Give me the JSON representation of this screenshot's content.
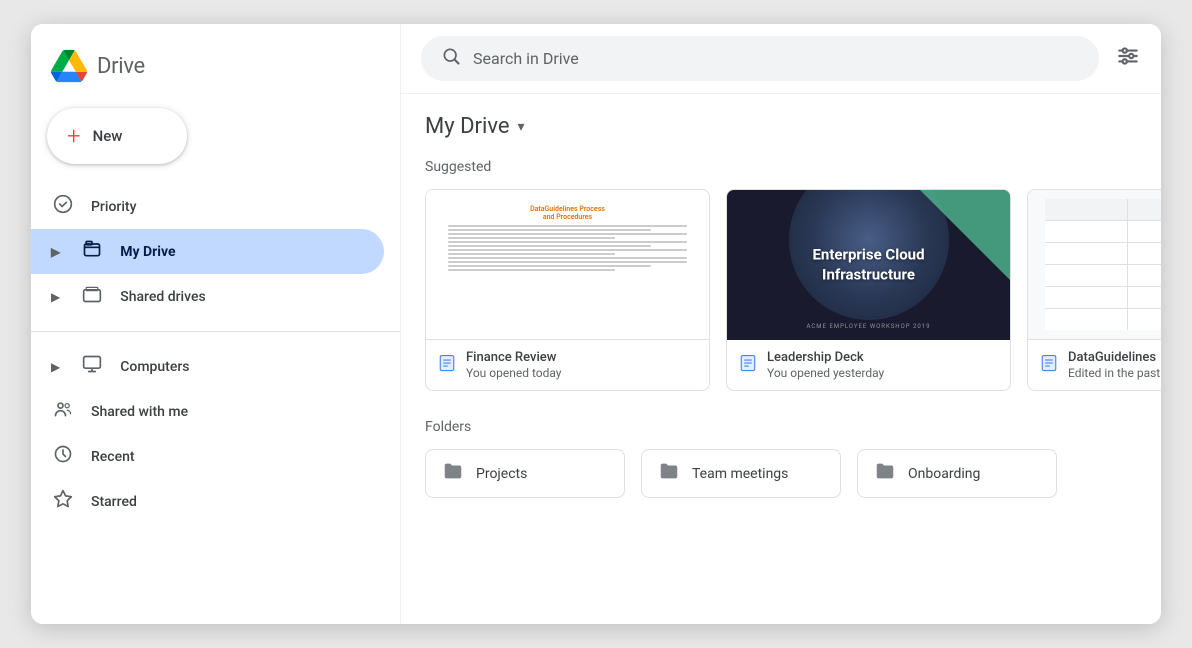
{
  "app": {
    "name": "Drive",
    "logo_alt": "Google Drive"
  },
  "search": {
    "placeholder": "Search in Drive",
    "icon": "🔍"
  },
  "sidebar": {
    "new_button_label": "New",
    "items": [
      {
        "id": "priority",
        "label": "Priority",
        "icon": "☑",
        "active": false,
        "expandable": false
      },
      {
        "id": "my-drive",
        "label": "My Drive",
        "icon": "🖥",
        "active": true,
        "expandable": true
      },
      {
        "id": "shared-drives",
        "label": "Shared drives",
        "icon": "🖥",
        "active": false,
        "expandable": true
      },
      {
        "id": "computers",
        "label": "Computers",
        "icon": "💻",
        "active": false,
        "expandable": true
      },
      {
        "id": "shared-with-me",
        "label": "Shared with me",
        "icon": "👥",
        "active": false,
        "expandable": false
      },
      {
        "id": "recent",
        "label": "Recent",
        "icon": "🕐",
        "active": false,
        "expandable": false
      },
      {
        "id": "starred",
        "label": "Starred",
        "icon": "☆",
        "active": false,
        "expandable": false
      }
    ]
  },
  "main": {
    "drive_title": "My Drive",
    "suggested_label": "Suggested",
    "folders_label": "Folders",
    "files": [
      {
        "id": "finance-review",
        "name": "Finance Review",
        "meta": "You opened today",
        "type": "doc",
        "preview_type": "doc"
      },
      {
        "id": "leadership-deck",
        "name": "Leadership Deck",
        "meta": "You opened yesterday",
        "type": "doc",
        "preview_type": "dark",
        "preview_title": "Enterprise Cloud Infrastructure",
        "preview_subtitle": "ACME EMPLOYEE WORKSHOP 2019"
      },
      {
        "id": "data-guidelines",
        "name": "DataGuidelines",
        "meta": "Edited in the past wee",
        "type": "doc",
        "preview_type": "spreadsheet"
      }
    ],
    "folders": [
      {
        "id": "projects",
        "name": "Projects",
        "icon": "📁"
      },
      {
        "id": "team-meetings",
        "name": "Team meetings",
        "icon": "📁"
      },
      {
        "id": "onboarding",
        "name": "Onboarding",
        "icon": "📁"
      }
    ]
  },
  "colors": {
    "accent_blue": "#4285f4",
    "active_nav_bg": "#c2d9ff",
    "active_nav_text": "#041e49",
    "sidebar_bg": "#ffffff",
    "search_bg": "#f1f3f4"
  }
}
